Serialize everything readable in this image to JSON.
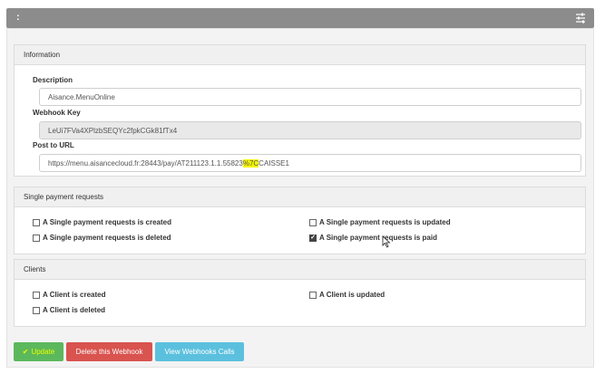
{
  "topbar": {
    "title": ":",
    "settings_icon": "sliders-icon"
  },
  "information": {
    "heading": "Information",
    "description_label": "Description",
    "description_value": "Aisance.MenuOnline",
    "webhook_key_label": "Webhook Key",
    "webhook_key_value": "LeUi7FVa4XPlzbSEQYc2fpkCGk81fTx4",
    "post_url_label": "Post to URL",
    "post_url_prefix": "https://menu.aisancecloud.fr:28443/pay/AT211123.1.1.55823",
    "post_url_highlight": "%7C",
    "post_url_suffix": "CAISSE1"
  },
  "single_payment": {
    "heading": "Single payment requests",
    "options": [
      {
        "label": "A Single payment requests is created",
        "checked": false
      },
      {
        "label": "A Single payment requests is updated",
        "checked": false
      },
      {
        "label": "A Single payment requests is deleted",
        "checked": false
      },
      {
        "label": "A Single payment requests is paid",
        "checked": true
      }
    ]
  },
  "clients": {
    "heading": "Clients",
    "options": [
      {
        "label": "A Client is created",
        "checked": false
      },
      {
        "label": "A Client is updated",
        "checked": false
      },
      {
        "label": "A Client is deleted",
        "checked": false
      }
    ]
  },
  "actions": {
    "update_label": "Update",
    "delete_label": "Delete this Webhook",
    "view_label": "View Webhooks Calls"
  },
  "colors": {
    "update": "#5cb85c",
    "delete": "#d9534f",
    "view": "#5bc0de",
    "highlight": "#f6f600"
  }
}
